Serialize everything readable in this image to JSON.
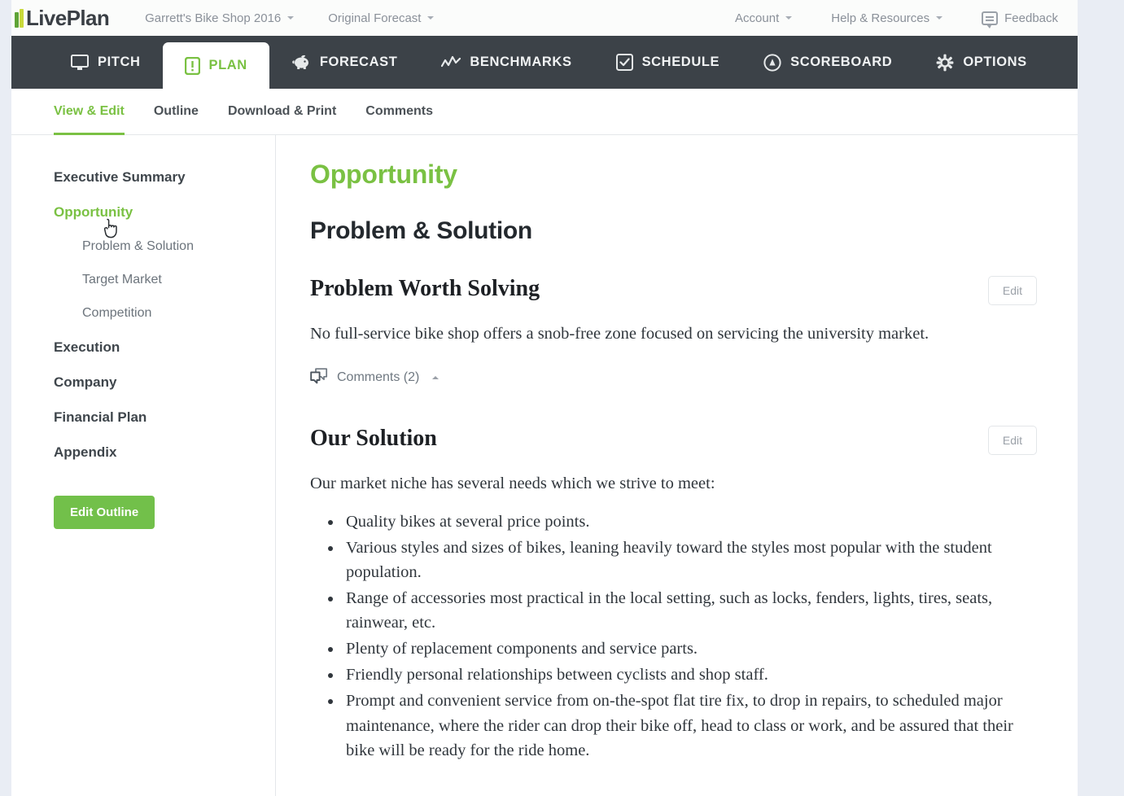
{
  "brand": {
    "logo_text": "LivePlan"
  },
  "topbar": {
    "company_selector": "Garrett's Bike Shop 2016",
    "forecast_selector": "Original Forecast",
    "account": "Account",
    "help": "Help & Resources",
    "feedback": "Feedback"
  },
  "mainnav": {
    "items": [
      {
        "label": "PITCH",
        "icon": "monitor-icon",
        "active": false
      },
      {
        "label": "PLAN",
        "icon": "document-icon",
        "active": true
      },
      {
        "label": "FORECAST",
        "icon": "piggy-bank-icon",
        "active": false
      },
      {
        "label": "BENCHMARKS",
        "icon": "line-chart-icon",
        "active": false
      },
      {
        "label": "SCHEDULE",
        "icon": "checkbox-icon",
        "active": false
      },
      {
        "label": "SCOREBOARD",
        "icon": "gauge-icon",
        "active": false
      },
      {
        "label": "OPTIONS",
        "icon": "gear-icon",
        "active": false
      }
    ]
  },
  "subnav": {
    "items": [
      {
        "label": "View & Edit",
        "active": true
      },
      {
        "label": "Outline",
        "active": false
      },
      {
        "label": "Download & Print",
        "active": false
      },
      {
        "label": "Comments",
        "active": false
      }
    ]
  },
  "sidebar": {
    "items": [
      {
        "label": "Executive Summary",
        "level": 1,
        "active": false
      },
      {
        "label": "Opportunity",
        "level": 1,
        "active": true
      },
      {
        "label": "Problem & Solution",
        "level": 2,
        "active": false
      },
      {
        "label": "Target Market",
        "level": 2,
        "active": false
      },
      {
        "label": "Competition",
        "level": 2,
        "active": false
      },
      {
        "label": "Execution",
        "level": 1,
        "active": false
      },
      {
        "label": "Company",
        "level": 1,
        "active": false
      },
      {
        "label": "Financial Plan",
        "level": 1,
        "active": false
      },
      {
        "label": "Appendix",
        "level": 1,
        "active": false
      }
    ],
    "edit_outline_label": "Edit Outline"
  },
  "content": {
    "page_title": "Opportunity",
    "section_title": "Problem & Solution",
    "edit_label": "Edit",
    "problem": {
      "heading": "Problem Worth Solving",
      "paragraph": "No full-service bike shop offers a snob-free zone focused on servicing the university market.",
      "comments_label": "Comments (2)"
    },
    "solution": {
      "heading": "Our Solution",
      "paragraph": "Our market niche has several needs which we strive to meet:",
      "bullets": [
        "Quality bikes at several price points.",
        "Various styles and sizes of bikes, leaning heavily toward the styles most popular with the student population.",
        "Range of accessories most practical in the local setting, such as locks, fenders, lights, tires, seats, rainwear, etc.",
        "Plenty of replacement components and service parts.",
        "Friendly personal relationships between cyclists and shop staff.",
        "Prompt and convenient service from on-the-spot flat tire fix, to drop in repairs, to scheduled major maintenance, where the rider can drop their bike off, head to class or work, and be assured that their bike will be ready for the ride home."
      ]
    }
  },
  "colors": {
    "brand_green": "#7ac143",
    "nav_dark": "#3c4248",
    "page_bg": "#e9edf4",
    "button_green": "#72c04a",
    "text_dark": "#3f464c",
    "text_muted": "#8a9099"
  }
}
